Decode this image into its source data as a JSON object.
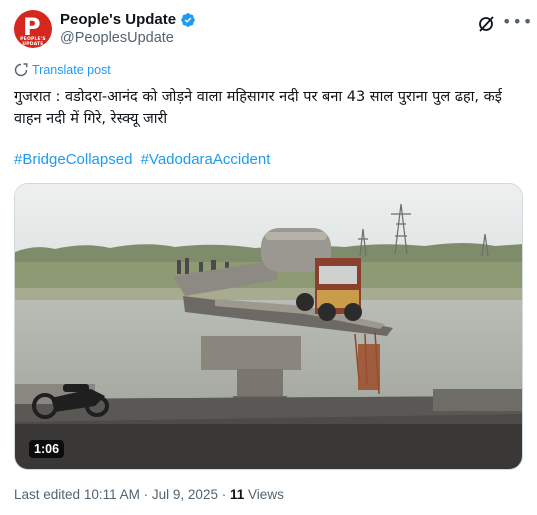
{
  "post": {
    "author": {
      "display_name": "People's Update",
      "handle": "@PeoplesUpdate",
      "avatar_letter": "P",
      "avatar_tagline": "PEOPLE'S UPDATE",
      "verified": true,
      "brand_color": "#d6271f"
    },
    "translate_label": "Translate post",
    "text": "गुजरात : वडोदरा-आनंद को जोड़ने वाला महिसागर नदी पर बना 43 साल पुराना पुल ढहा, कई वाहन नदी में गिरे, रेस्क्यू जारी",
    "hashtags": [
      "#BridgeCollapsed",
      "#VadodaraAccident"
    ],
    "media": {
      "type": "video",
      "duration": "1:06"
    },
    "meta": {
      "edited_label": "Last edited",
      "time": "10:11 AM",
      "date": "Jul 9, 2025",
      "views_count": "11",
      "views_label": "Views"
    }
  },
  "colors": {
    "link": "#1d9bf0",
    "muted": "#536471",
    "text": "#0f1419",
    "verified": "#1d9bf0"
  }
}
